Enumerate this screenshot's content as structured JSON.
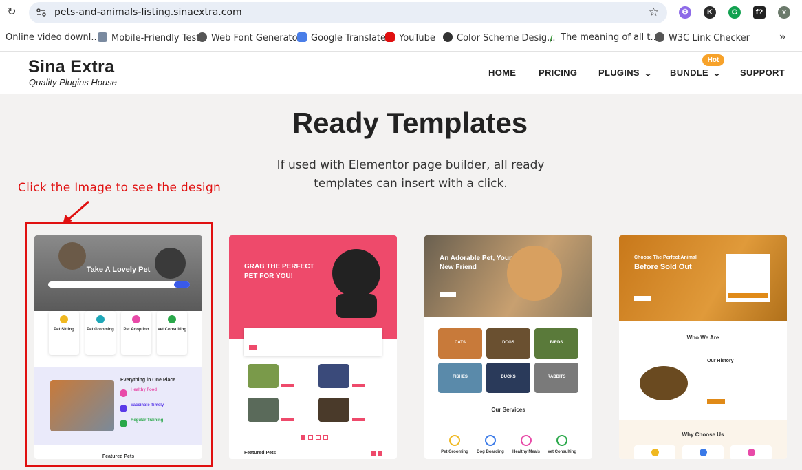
{
  "browser": {
    "url": "pets-and-animals-listing.sinaextra.com",
    "bookmarks": [
      {
        "label": "Online video downl...",
        "icon": "globe-icon"
      },
      {
        "label": "Mobile-Friendly Test",
        "icon": "robot-icon"
      },
      {
        "label": "Web Font Generator",
        "icon": "globe-icon"
      },
      {
        "label": "Google Translate",
        "icon": "translate-icon"
      },
      {
        "label": "YouTube",
        "icon": "youtube-icon"
      },
      {
        "label": "Color Scheme Desig...",
        "icon": "palette-icon"
      },
      {
        "label": "The meaning of all t...",
        "icon": "code-icon"
      },
      {
        "label": "W3C Link Checker",
        "icon": "globe-icon"
      }
    ]
  },
  "site": {
    "logo_title": "Sina Extra",
    "logo_tagline": "Quality Plugins House",
    "nav": {
      "home": "HOME",
      "pricing": "PRICING",
      "plugins": "PLUGINS",
      "bundle": "BUNDLE",
      "support": "SUPPORT",
      "hot_badge": "Hot"
    }
  },
  "hero": {
    "title": "Ready Templates",
    "subtitle": "If used with Elementor page builder, all ready templates can insert with a click.",
    "instruction": "Click the Image to see the design"
  },
  "templates": {
    "t1": {
      "hero": "Take A Lovely Pet",
      "services": [
        "Pet Sitting",
        "Pet Grooming",
        "Pet Adoption",
        "Vet Consulting"
      ],
      "section": "Everything in One Place",
      "features": [
        "Healthy Food",
        "Vaccinate Timely",
        "Regular Training"
      ],
      "footer": "Featured Pets"
    },
    "t2": {
      "hero": "GRAB THE PERFECT PET FOR YOU!",
      "footer": "Featured Pets"
    },
    "t3": {
      "hero": "An Adorable Pet, Your New Friend",
      "categories": [
        "CATS",
        "DOGS",
        "BIRDS",
        "FISHES",
        "DUCKS",
        "RABBITS"
      ],
      "section": "Our Services",
      "services": [
        "Pet Grooming",
        "Dog Boarding",
        "Healthy Meals",
        "Vet Consulting"
      ]
    },
    "t4": {
      "kicker": "Choose The Perfect Animal",
      "hero": "Before Sold Out",
      "section": "Who We Are",
      "history": "Our History",
      "footer": "Why Choose Us"
    }
  },
  "colors": {
    "accent_red": "#e01010",
    "hot_badge": "#f7a22a",
    "pink": "#ee4a6b",
    "orange": "#e08a18"
  }
}
